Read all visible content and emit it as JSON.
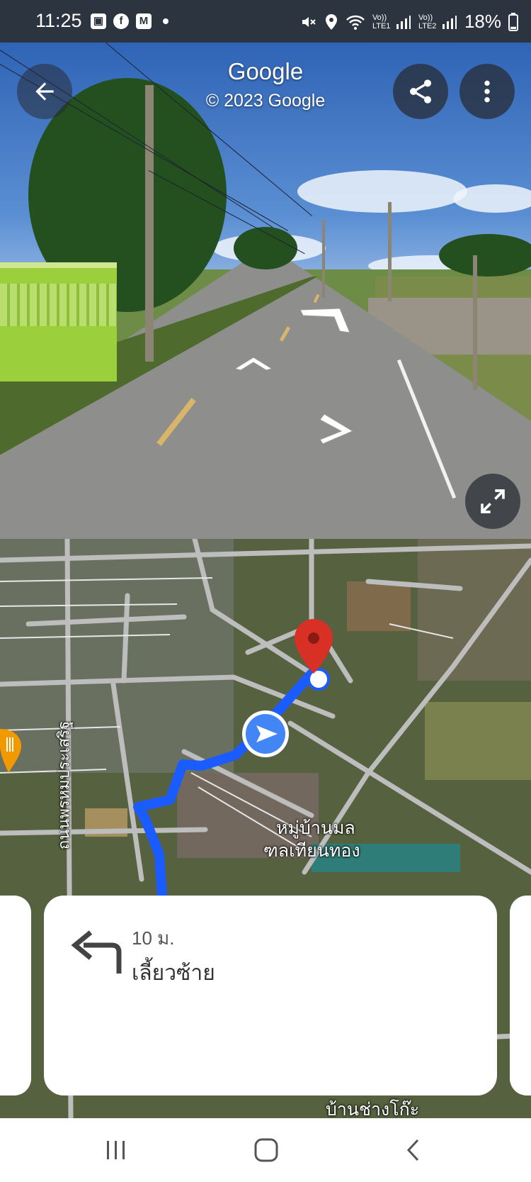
{
  "status_bar": {
    "time": "11:25",
    "left_icons": [
      "gallery-icon",
      "facebook-icon",
      "gmail-icon",
      "notification-dot-icon"
    ],
    "right_icons": [
      "mute-icon",
      "location-icon",
      "wifi-icon",
      "signal-lte1-icon",
      "signal-lte2-icon",
      "battery-icon"
    ],
    "sim1_label": "Vo)) LTE1",
    "sim2_label": "Vo)) LTE2",
    "battery_percent": "18%",
    "battery_level": 0.18
  },
  "street_view": {
    "title": "Google",
    "copyright": "© 2023 Google",
    "buttons": {
      "back": "back-arrow-icon",
      "share": "share-icon",
      "more": "more-vert-icon",
      "expand": "expand-icon"
    }
  },
  "map": {
    "labels": {
      "road_name": "ถนนพรหมประเสริฐ",
      "village_line1": "หมู่บ้านมล",
      "village_line2": "ฑลเทียนทอง",
      "village_bottom": "บ้านช่างโก๊ะ"
    },
    "colors": {
      "route": "#1a5cff",
      "destination_pin": "#d93025",
      "location_puck": "#4285f4"
    }
  },
  "turn_card": {
    "distance": "10 ม.",
    "instruction": "เลี้ยวซ้าย",
    "icon": "turn-left-icon"
  },
  "nav_bar": {
    "buttons": [
      "recents-icon",
      "home-icon",
      "back-icon"
    ]
  }
}
